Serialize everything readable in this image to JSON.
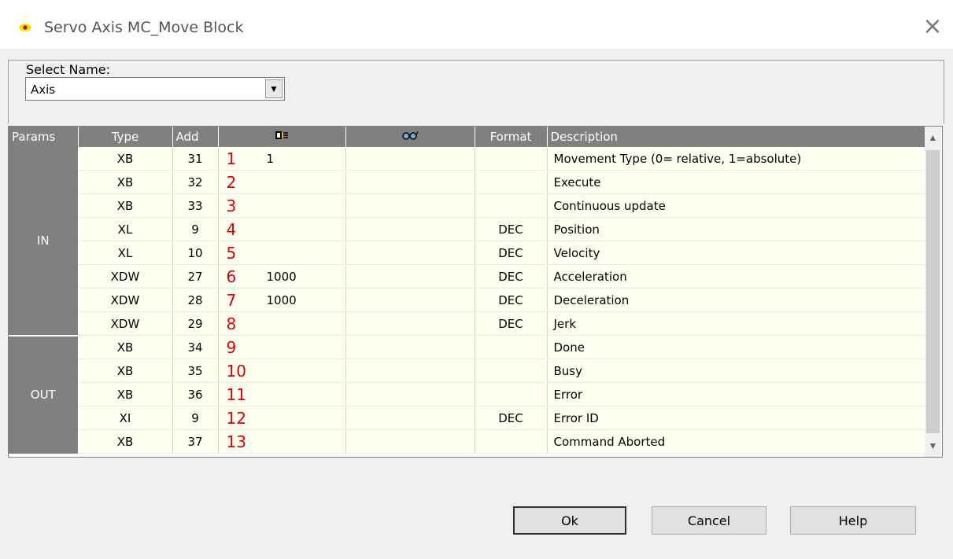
{
  "window": {
    "title": "Servo Axis MC_Move Block"
  },
  "select": {
    "group_label": "Select Name:",
    "value": "Axis"
  },
  "grid": {
    "headers": {
      "params": "Params",
      "type": "Type",
      "add": "Add",
      "plc_icon": "plc-icon",
      "watch_icon": "glasses-icon",
      "format": "Format",
      "description": "Description"
    },
    "groups": {
      "in": "IN",
      "out": "OUT"
    },
    "rows": [
      {
        "type": "XB",
        "add": "31",
        "num": "1",
        "value": "1",
        "format": "",
        "desc": "Movement Type (0= relative, 1=absolute)"
      },
      {
        "type": "XB",
        "add": "32",
        "num": "2",
        "value": "",
        "format": "",
        "desc": "Execute"
      },
      {
        "type": "XB",
        "add": "33",
        "num": "3",
        "value": "",
        "format": "",
        "desc": "Continuous update"
      },
      {
        "type": "XL",
        "add": "9",
        "num": "4",
        "value": "",
        "format": "DEC",
        "desc": "Position"
      },
      {
        "type": "XL",
        "add": "10",
        "num": "5",
        "value": "",
        "format": "DEC",
        "desc": "Velocity"
      },
      {
        "type": "XDW",
        "add": "27",
        "num": "6",
        "value": "1000",
        "format": "DEC",
        "desc": "Acceleration"
      },
      {
        "type": "XDW",
        "add": "28",
        "num": "7",
        "value": "1000",
        "format": "DEC",
        "desc": "Deceleration"
      },
      {
        "type": "XDW",
        "add": "29",
        "num": "8",
        "value": "",
        "format": "DEC",
        "desc": "Jerk"
      },
      {
        "type": "XB",
        "add": "34",
        "num": "9",
        "value": "",
        "format": "",
        "desc": "Done"
      },
      {
        "type": "XB",
        "add": "35",
        "num": "10",
        "value": "",
        "format": "",
        "desc": "Busy"
      },
      {
        "type": "XB",
        "add": "36",
        "num": "11",
        "value": "",
        "format": "",
        "desc": "Error"
      },
      {
        "type": "XI",
        "add": "9",
        "num": "12",
        "value": "",
        "format": "DEC",
        "desc": "Error ID"
      },
      {
        "type": "XB",
        "add": "37",
        "num": "13",
        "value": "",
        "format": "",
        "desc": "Command Aborted"
      }
    ]
  },
  "buttons": {
    "ok": "Ok",
    "cancel": "Cancel",
    "help": "Help"
  },
  "colors": {
    "header_bg": "#808080",
    "cell_bg": "#fffff2",
    "annotation_red": "#e00000"
  }
}
